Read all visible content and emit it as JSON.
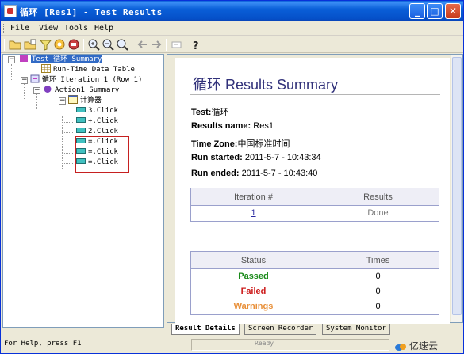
{
  "window": {
    "title": "循环 [Res1] - Test Results"
  },
  "menu": [
    {
      "label": "File"
    },
    {
      "label": "View"
    },
    {
      "label": "Tools"
    },
    {
      "label": "Help"
    }
  ],
  "tree": {
    "root": "Test 循环 Summary",
    "runtime_table": "Run-Time Data Table",
    "iteration": "循环 Iteration 1 (Row 1)",
    "action": "Action1 Summary",
    "app": "计算器",
    "steps": [
      "3.Click",
      "+.Click",
      "2.Click",
      "=.Click",
      "=.Click",
      "=.Click"
    ]
  },
  "summary": {
    "title_prefix": "循环",
    "title": "Results Summary",
    "test_label": "Test:",
    "test_value": "循环",
    "results_name_label": "Results name:",
    "results_name_value": "Res1",
    "time_zone_label": "Time Zone:",
    "time_zone_value": "中国标准时间",
    "run_started_label": "Run started:",
    "run_started_value": "2011-5-7 - 10:43:34",
    "run_ended_label": "Run ended:",
    "run_ended_value": "2011-5-7 - 10:43:40"
  },
  "iterations_table": {
    "headers": [
      "Iteration #",
      "Results"
    ],
    "rows": [
      {
        "iteration": "1",
        "result": "Done"
      }
    ]
  },
  "status_table": {
    "headers": [
      "Status",
      "Times"
    ],
    "rows": [
      {
        "status": "Passed",
        "times": "0",
        "color": "#1a8a1a"
      },
      {
        "status": "Failed",
        "times": "0",
        "color": "#cc1a1a"
      },
      {
        "status": "Warnings",
        "times": "0",
        "color": "#e8903a"
      }
    ]
  },
  "tabs": [
    "Result Details",
    "Screen Recorder",
    "System Monitor"
  ],
  "status_bar": {
    "help": "For Help, press F1",
    "state": "Ready"
  },
  "watermark": "亿速云",
  "colors": {
    "accent": "#31317a",
    "selection": "#316ac5",
    "highlight_box": "#c62020"
  }
}
